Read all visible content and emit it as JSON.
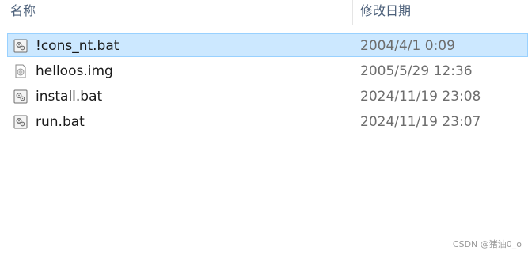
{
  "header": {
    "name_label": "名称",
    "date_label": "修改日期"
  },
  "files": [
    {
      "name": "!cons_nt.bat",
      "modified": "2004/4/1 0:09",
      "icon": "batch-file-icon",
      "selected": true
    },
    {
      "name": "helloos.img",
      "modified": "2005/5/29 12:36",
      "icon": "disk-image-icon",
      "selected": false
    },
    {
      "name": "install.bat",
      "modified": "2024/11/19 23:08",
      "icon": "batch-file-icon",
      "selected": false
    },
    {
      "name": "run.bat",
      "modified": "2024/11/19 23:07",
      "icon": "batch-file-icon",
      "selected": false
    }
  ],
  "watermark": "CSDN @猪油0_o",
  "colors": {
    "selection_bg": "#cce8ff",
    "selection_border": "#99d1ff",
    "header_text": "#4c607a",
    "date_text": "#6d6d6d"
  }
}
